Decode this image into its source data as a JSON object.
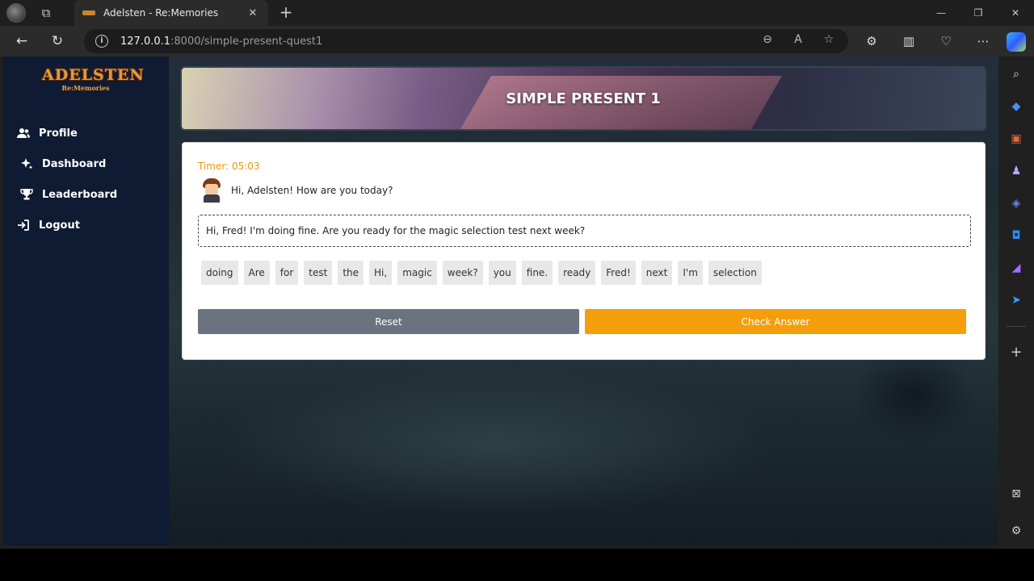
{
  "browser": {
    "tab_title": "Adelsten - Re:Memories",
    "close_glyph": "✕",
    "newtab_glyph": "+",
    "url_host": "127.0.0.1",
    "url_rest": ":8000/simple-present-quest1",
    "info_glyph": "i"
  },
  "app": {
    "logo_main": "ADELSTEN",
    "logo_sub": "Re:Memories"
  },
  "sidebar": {
    "items": [
      {
        "label": "Profile"
      },
      {
        "label": "Dashboard"
      },
      {
        "label": "Leaderboard"
      },
      {
        "label": "Logout"
      }
    ]
  },
  "quest": {
    "title": "SIMPLE PRESENT 1",
    "timer": "Timer: 05:03",
    "npc_line": "Hi, Adelsten! How are you today?",
    "answer": "Hi, Fred! I'm doing fine. Are you ready for the magic selection test next week?",
    "words": [
      "doing",
      "Are",
      "for",
      "test",
      "the",
      "Hi,",
      "magic",
      "week?",
      "you",
      "fine.",
      "ready",
      "Fred!",
      "next",
      "I'm",
      "selection"
    ],
    "reset_label": "Reset",
    "check_label": "Check Answer"
  },
  "colors": {
    "timer": "#e59a14",
    "check_button": "#f59e0b",
    "reset_button": "#6b7280",
    "sidebar_bg": "#0f1a33"
  }
}
